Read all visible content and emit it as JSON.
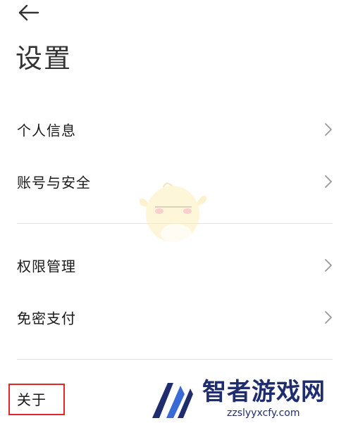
{
  "header": {
    "title": "设置"
  },
  "menu": {
    "items": [
      {
        "label": "个人信息"
      },
      {
        "label": "账号与安全"
      },
      {
        "label": "权限管理"
      },
      {
        "label": "免密支付"
      }
    ],
    "about_label": "关于"
  },
  "watermark": {
    "name": "智者游戏网",
    "url": "zzslyyxcfy.com"
  },
  "colors": {
    "highlight_border": "#e0282a",
    "divider": "#e4e4e4",
    "chevron": "#999999"
  },
  "icons": {
    "back": "back-arrow-icon",
    "chevron": "chevron-right-icon"
  }
}
